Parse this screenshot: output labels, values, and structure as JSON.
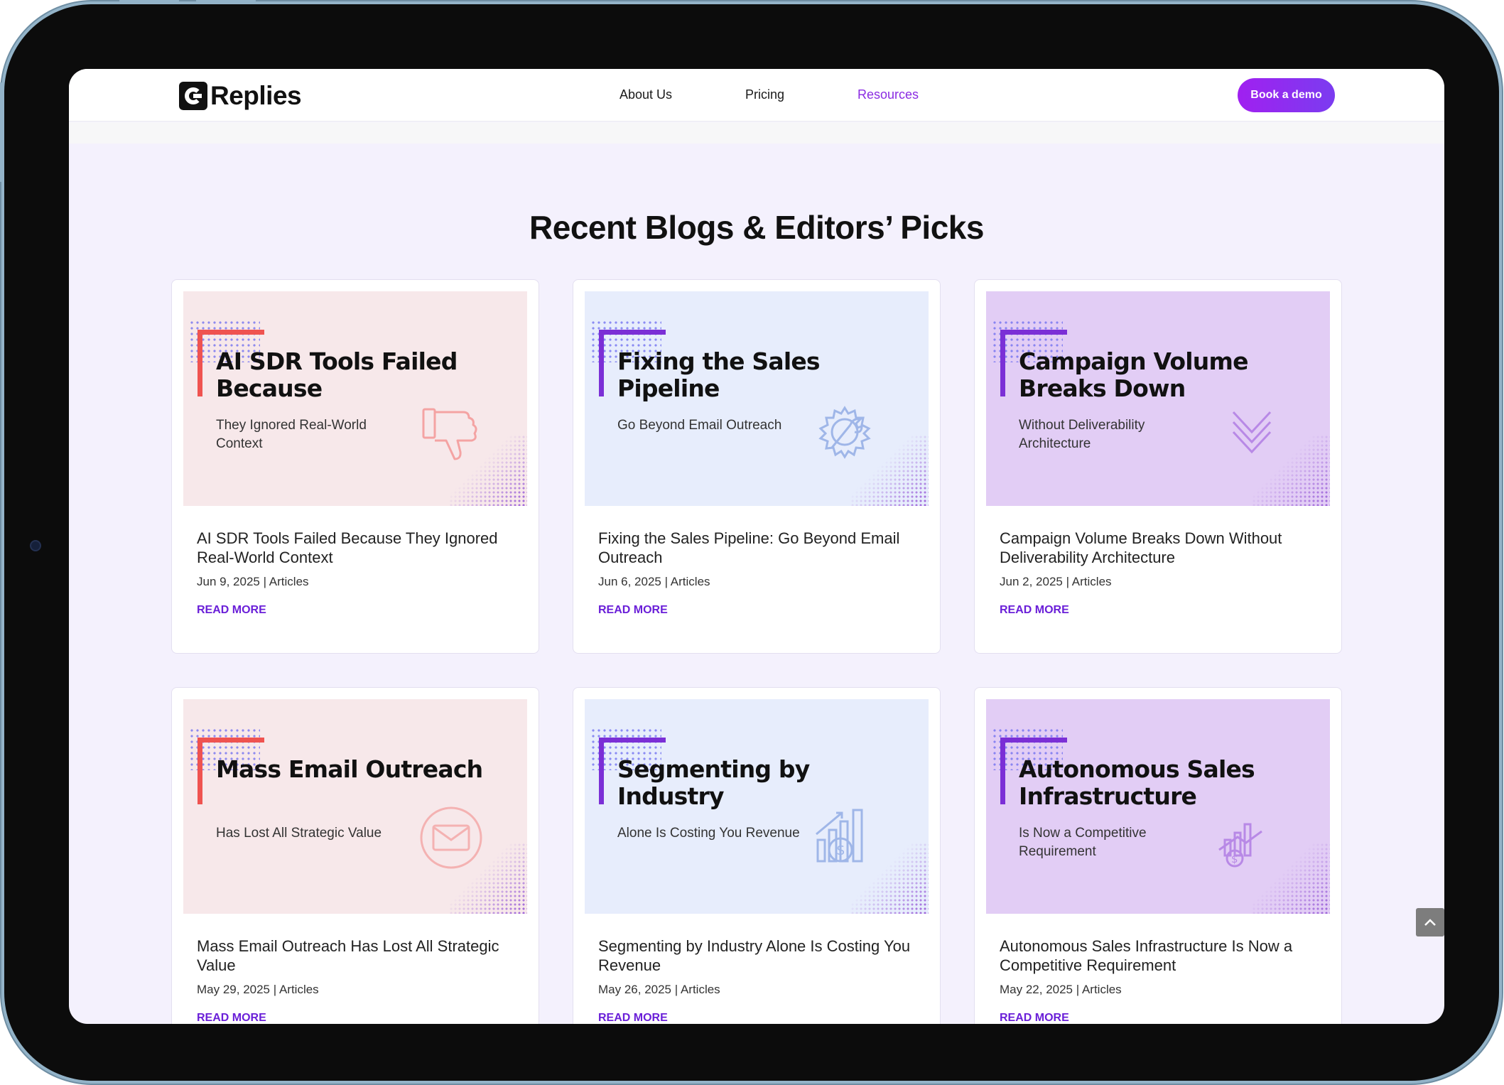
{
  "header": {
    "logo_text": "Replies",
    "nav": [
      "About Us",
      "Pricing",
      "Resources"
    ],
    "cta": "Book a demo"
  },
  "section": {
    "title": "Recent Blogs & Editors’ Picks"
  },
  "cards": [
    {
      "image_title": "AI SDR Tools Failed Because",
      "image_subtitle": "They Ignored Real-World Context",
      "title": "AI SDR Tools Failed Because They Ignored Real-World Context",
      "date": "Jun 9, 2025",
      "category": "Articles",
      "read_more": "READ MORE",
      "icon": "thumbs-down-icon"
    },
    {
      "image_title": "Fixing the Sales Pipeline",
      "image_subtitle": "Go Beyond Email Outreach",
      "title": "Fixing the Sales Pipeline: Go Beyond Email Outreach",
      "date": "Jun 6, 2025",
      "category": "Articles",
      "read_more": "READ MORE",
      "icon": "gear-wrench-icon"
    },
    {
      "image_title": "Campaign Volume Breaks Down",
      "image_subtitle": "Without Deliverability Architecture",
      "title": "Campaign Volume Breaks Down Without Deliverability Architecture",
      "date": "Jun 2, 2025",
      "category": "Articles",
      "read_more": "READ MORE",
      "icon": "chevrons-down-icon"
    },
    {
      "image_title": "Mass Email Outreach",
      "image_subtitle": "Has Lost All Strategic Value",
      "title": "Mass Email Outreach Has Lost All Strategic Value",
      "date": "May 29, 2025",
      "category": "Articles",
      "read_more": "READ MORE",
      "icon": "envelope-icon"
    },
    {
      "image_title": "Segmenting by Industry",
      "image_subtitle": "Alone Is Costing You Revenue",
      "title": "Segmenting by Industry Alone Is Costing You Revenue",
      "date": "May 26, 2025",
      "category": "Articles",
      "read_more": "READ MORE",
      "icon": "dollar-chart-icon"
    },
    {
      "image_title": "Autonomous Sales Infrastructure",
      "image_subtitle": "Is Now a Competitive Requirement",
      "title": "Autonomous Sales Infrastructure Is Now a Competitive Requirement",
      "date": "May 22, 2025",
      "category": "Articles",
      "read_more": "READ MORE",
      "icon": "growth-chart-icon"
    }
  ],
  "colors": {
    "accent": "#8a2be2",
    "page_bg": "#f4f1fd",
    "pink_thumb": "#f7e8ea",
    "blue_thumb": "#e7edfc",
    "purple_thumb": "#e2cdf5"
  }
}
